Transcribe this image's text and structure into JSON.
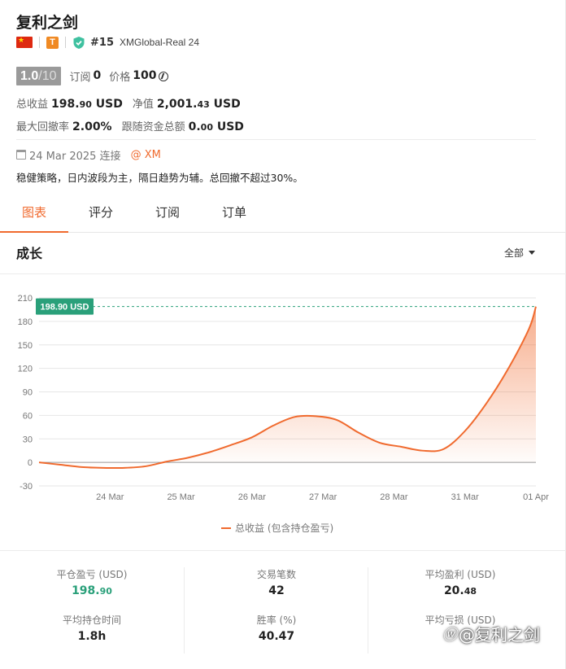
{
  "header": {
    "title": "复利之剑",
    "badge_letter": "T",
    "rank": "#15",
    "server": "XMGlobal-Real 24"
  },
  "rating": {
    "score": "1.0",
    "score_total": "/10",
    "subscribe_label": "订阅",
    "subscribe_count": "0",
    "price_label": "价格",
    "price_value": "100"
  },
  "metrics": {
    "total_profit_label": "总收益",
    "total_profit_int": "198.",
    "total_profit_dec": "90",
    "total_profit_unit": " USD",
    "equity_label": "净值",
    "equity_int": "2,001.",
    "equity_dec": "43",
    "equity_unit": " USD",
    "max_drawdown_label": "最大回撤率",
    "max_drawdown_value": "2.00%",
    "copy_funds_label": "跟随资金总额",
    "copy_funds_int": "0.",
    "copy_funds_dec": "00",
    "copy_funds_unit": " USD"
  },
  "connection": {
    "date_text": "24 Mar 2025 连接",
    "broker": "@ XM"
  },
  "strategy_text": "稳健策略，日内波段为主，隔日趋势为辅。总回撤不超过30%。",
  "tabs": [
    {
      "label": "图表",
      "active": true
    },
    {
      "label": "评分",
      "active": false
    },
    {
      "label": "订阅",
      "active": false
    },
    {
      "label": "订单",
      "active": false
    }
  ],
  "growth": {
    "title": "成长",
    "range_label": "全部"
  },
  "chart_data": {
    "type": "area",
    "title": "",
    "xlabel": "",
    "ylabel": "",
    "ylim": [
      -30,
      210
    ],
    "yticks": [
      -30,
      0,
      30,
      60,
      90,
      120,
      150,
      180,
      210
    ],
    "xlim": [
      0,
      7
    ],
    "xticks": [
      {
        "x": 1,
        "label": "24 Mar"
      },
      {
        "x": 2,
        "label": "25 Mar"
      },
      {
        "x": 3,
        "label": "26 Mar"
      },
      {
        "x": 4,
        "label": "27 Mar"
      },
      {
        "x": 5,
        "label": "28 Mar"
      },
      {
        "x": 6,
        "label": "31 Mar"
      },
      {
        "x": 7,
        "label": "01 Apr"
      }
    ],
    "series": [
      {
        "name": "总收益 (包含持仓盈亏)",
        "color": "#f06a2e",
        "x": [
          0,
          0.3,
          0.6,
          0.9,
          1.2,
          1.5,
          1.8,
          2.1,
          2.4,
          2.7,
          3.0,
          3.3,
          3.6,
          3.9,
          4.2,
          4.5,
          4.8,
          5.1,
          5.4,
          5.7,
          6.0,
          6.3,
          6.6,
          6.9,
          7.0
        ],
        "y": [
          0,
          -3,
          -6,
          -7,
          -7,
          -5,
          1,
          6,
          13,
          22,
          32,
          47,
          58,
          59,
          54,
          38,
          25,
          20,
          15,
          17,
          40,
          75,
          118,
          170,
          198.9
        ]
      }
    ],
    "current_value_label": "198.90 USD",
    "current_value": 198.9,
    "grid": true,
    "legend_position": "bottom"
  },
  "stats": {
    "closed_pnl_label": "平仓盈亏 (USD)",
    "closed_pnl_int": "198.",
    "closed_pnl_dec": "90",
    "trades_label": "交易笔数",
    "trades_value": "42",
    "avg_profit_label": "平均盈利 (USD)",
    "avg_profit_int": "20.",
    "avg_profit_dec": "48",
    "avg_hold_label": "平均持仓时间",
    "avg_hold_value": "1.8h",
    "win_rate_label": "胜率 (%)",
    "win_rate_value": "40.47",
    "avg_loss_label": "平均亏损 (USD)"
  },
  "watermark": {
    "text": "@复利之剑"
  },
  "colors": {
    "accent": "#f06a2e",
    "positive": "#2aa07a",
    "flag_red": "#de2910",
    "badge_orange": "#f08a24",
    "shield_teal": "#3fc1a0"
  }
}
